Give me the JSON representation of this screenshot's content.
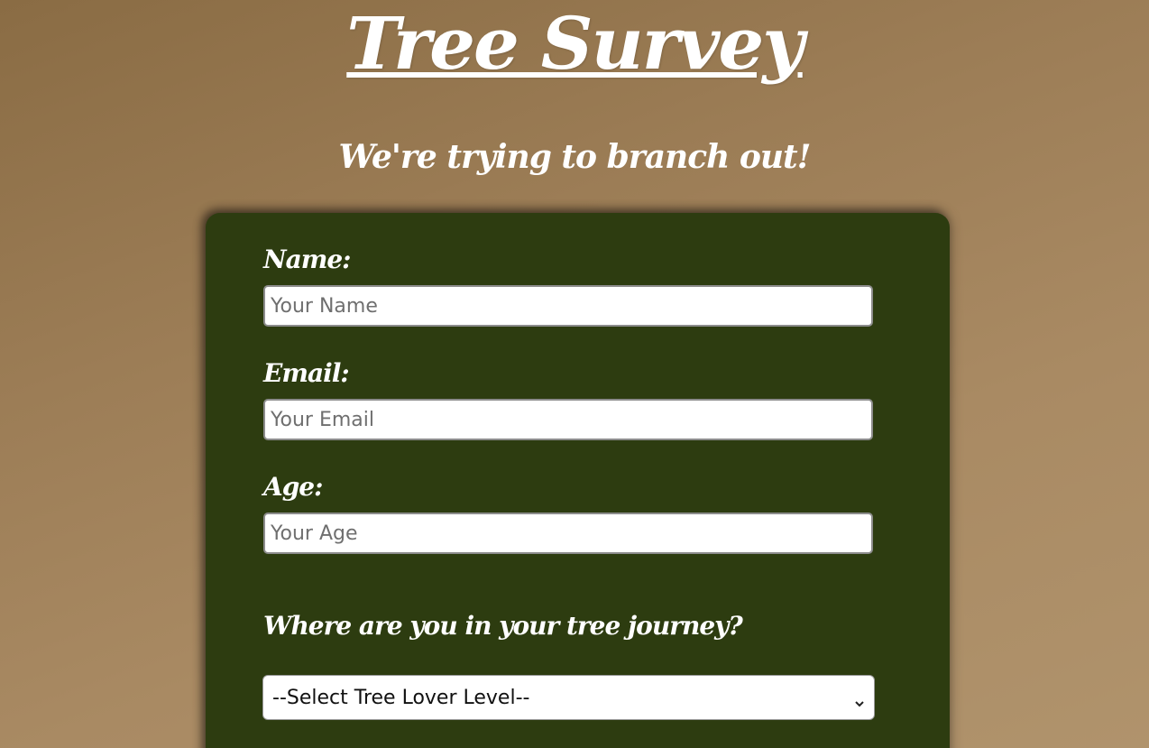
{
  "header": {
    "title": "Tree Survey",
    "subtitle": "We're trying to branch out!"
  },
  "form": {
    "name": {
      "label": "Name:",
      "placeholder": "Your Name",
      "value": ""
    },
    "email": {
      "label": "Email:",
      "placeholder": "Your Email",
      "value": ""
    },
    "age": {
      "label": "Age:",
      "placeholder": "Your Age",
      "value": ""
    },
    "journey": {
      "question": "Where are you in your tree journey?",
      "selected": "--Select Tree Lover Level--"
    }
  },
  "colors": {
    "background": "#9c7d56",
    "card": "#2d3c10",
    "text": "#ffffff"
  },
  "icons": {
    "select_arrow": "chevron-down-icon"
  }
}
